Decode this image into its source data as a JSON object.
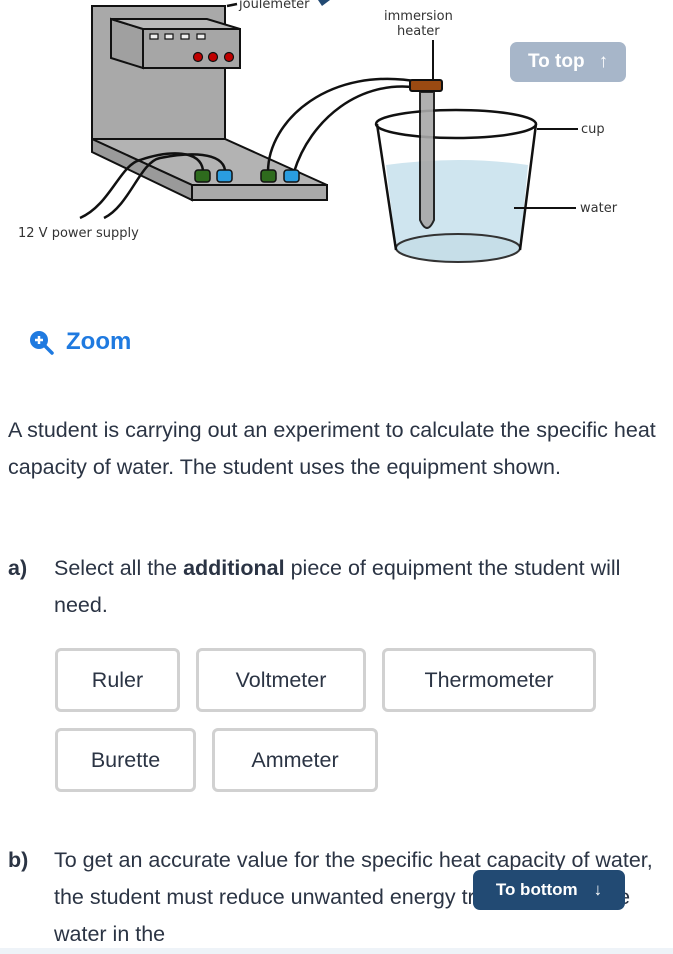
{
  "diagram": {
    "labels": {
      "joulemeter": "joulemeter",
      "immersion_heater_line1": "immersion",
      "immersion_heater_line2": "heater",
      "cup": "cup",
      "water": "water",
      "power_supply": "12 V power supply"
    },
    "colors": {
      "apparatus_gray": "#a9a9a9",
      "terminal_green": "#2e6b1d",
      "terminal_blue": "#2a9de0",
      "indicator_red": "#c00000",
      "heater_cap": "#9a4a12",
      "water": "#cfe5ef"
    }
  },
  "nav": {
    "to_top_label": "To top",
    "to_top_arrow": "↑",
    "to_bottom_label": "To bottom",
    "to_bottom_arrow": "↓"
  },
  "zoom": {
    "label": "Zoom",
    "icon": "zoom-in-icon",
    "color": "#1f7ae0"
  },
  "intro": "A student is carrying out an experiment to calculate the specific heat capacity of water. The student uses the equipment shown.",
  "question_a": {
    "label": "a)",
    "text_before": "Select all the ",
    "text_bold": "additional",
    "text_after": " piece of equipment the student will need.",
    "options": [
      "Ruler",
      "Voltmeter",
      "Thermometer",
      "Burette",
      "Ammeter"
    ]
  },
  "question_b": {
    "label": "b)",
    "text": "To get an accurate value for the specific heat capacity of water, the student must reduce unwanted energy transfers from the water in the"
  }
}
